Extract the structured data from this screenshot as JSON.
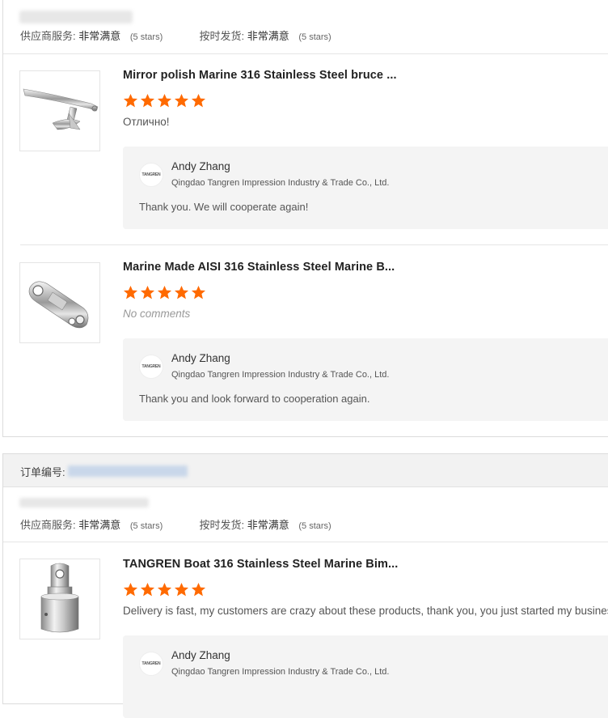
{
  "colors": {
    "star": "#ff6a00",
    "reply_bg": "#f4f4f4",
    "order_header_bg": "#f2f2f2"
  },
  "orders": [
    {
      "ratings": {
        "supplier_label": "供应商服务:",
        "supplier_value": "非常满意",
        "supplier_stars": "(5 stars)",
        "delivery_label": "按时发货:",
        "delivery_value": "非常满意",
        "delivery_stars": "(5 stars)"
      },
      "items": [
        {
          "title": "Mirror polish Marine 316 Stainless Steel bruce ...",
          "rating": 5,
          "comment": "Отлично!",
          "reply": {
            "avatar_text": "TANGREN",
            "name": "Andy Zhang",
            "company": "Qingdao Tangren Impression Industry & Trade Co., Ltd.",
            "text": "Thank you. We will cooperate again!"
          }
        },
        {
          "title": "Marine Made AISI 316 Stainless Steel Marine B...",
          "rating": 5,
          "comment": "No comments",
          "reply": {
            "avatar_text": "TANGREN",
            "name": "Andy Zhang",
            "company": "Qingdao Tangren Impression Industry & Trade Co., Ltd.",
            "text": "Thank you and look forward to cooperation again."
          }
        }
      ]
    },
    {
      "order_label": "订单编号:",
      "ratings": {
        "supplier_label": "供应商服务:",
        "supplier_value": "非常满意",
        "supplier_stars": "(5 stars)",
        "delivery_label": "按时发货:",
        "delivery_value": "非常满意",
        "delivery_stars": "(5 stars)"
      },
      "items": [
        {
          "title": "TANGREN Boat 316 Stainless Steel Marine Bim...",
          "rating": 5,
          "comment": "Delivery is fast, my customers are crazy about these products, thank you, you just started my business",
          "reply": {
            "avatar_text": "TANGREN",
            "name": "Andy Zhang",
            "company": "Qingdao Tangren Impression Industry & Trade Co., Ltd.",
            "text": ""
          }
        }
      ]
    }
  ]
}
